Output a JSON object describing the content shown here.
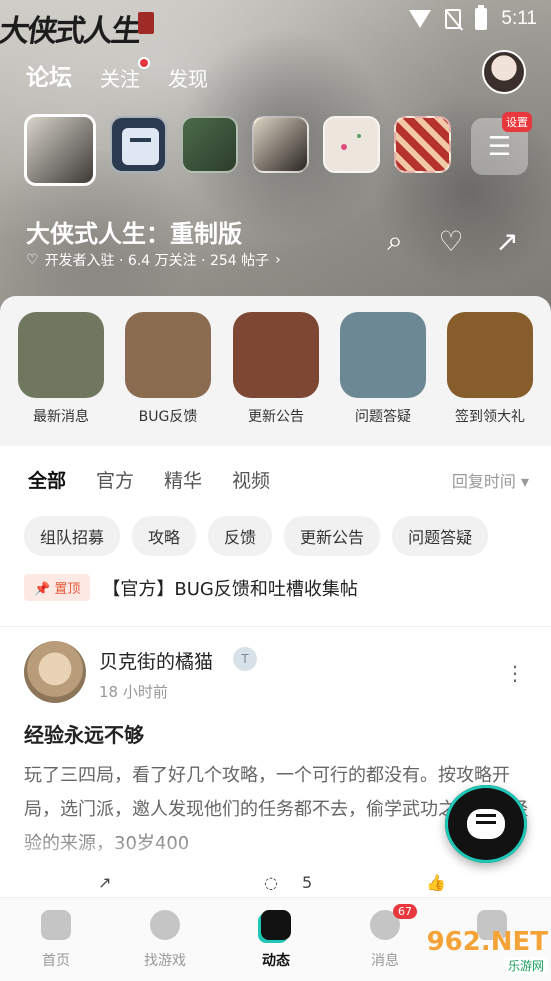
{
  "status": {
    "time": "5:11"
  },
  "banner": {
    "calligraphy": "大侠式人生",
    "top_tabs": [
      {
        "label": "论坛",
        "active": true
      },
      {
        "label": "关注",
        "has_dot": true
      },
      {
        "label": "发现"
      }
    ],
    "settings_badge": "设置",
    "game_title": "大侠式人生：重制版",
    "meta": "开发者入驻 · 6.4 万关注 · 254 帖子"
  },
  "categories": [
    {
      "label": "最新消息",
      "color": "#6f775f"
    },
    {
      "label": "BUG反馈",
      "color": "#8c6c51"
    },
    {
      "label": "更新公告",
      "color": "#7d4733"
    },
    {
      "label": "问题答疑",
      "color": "#6b8894"
    },
    {
      "label": "签到领大礼",
      "color": "#875e2b"
    }
  ],
  "filters": {
    "tabs": [
      "全部",
      "官方",
      "精华",
      "视频"
    ],
    "sort": "回复时间 ▾",
    "chips": [
      "组队招募",
      "攻略",
      "反馈",
      "更新公告",
      "问题答疑"
    ],
    "pinned_tag": "置顶",
    "pinned_text": "【官方】BUG反馈和吐槽收集帖"
  },
  "post": {
    "author": "贝克街的橘猫",
    "badge": "T",
    "time": "18 小时前",
    "title": "经验永远不够",
    "body": "玩了三四局，看了好几个攻略，一个可行的都没有。按攻略开局，选门派，邀人发现他们的任务都不去，偷学武功之后发愁经验的来源，30岁400",
    "comments": "5"
  },
  "bottom_nav": [
    {
      "label": "首页"
    },
    {
      "label": "找游戏"
    },
    {
      "label": "动态",
      "active": true
    },
    {
      "label": "消息",
      "count": "67"
    },
    {
      "label": ""
    }
  ],
  "watermark": {
    "line1": "962.NET",
    "line2": "乐游网"
  },
  "accent": "#1fc7b6"
}
